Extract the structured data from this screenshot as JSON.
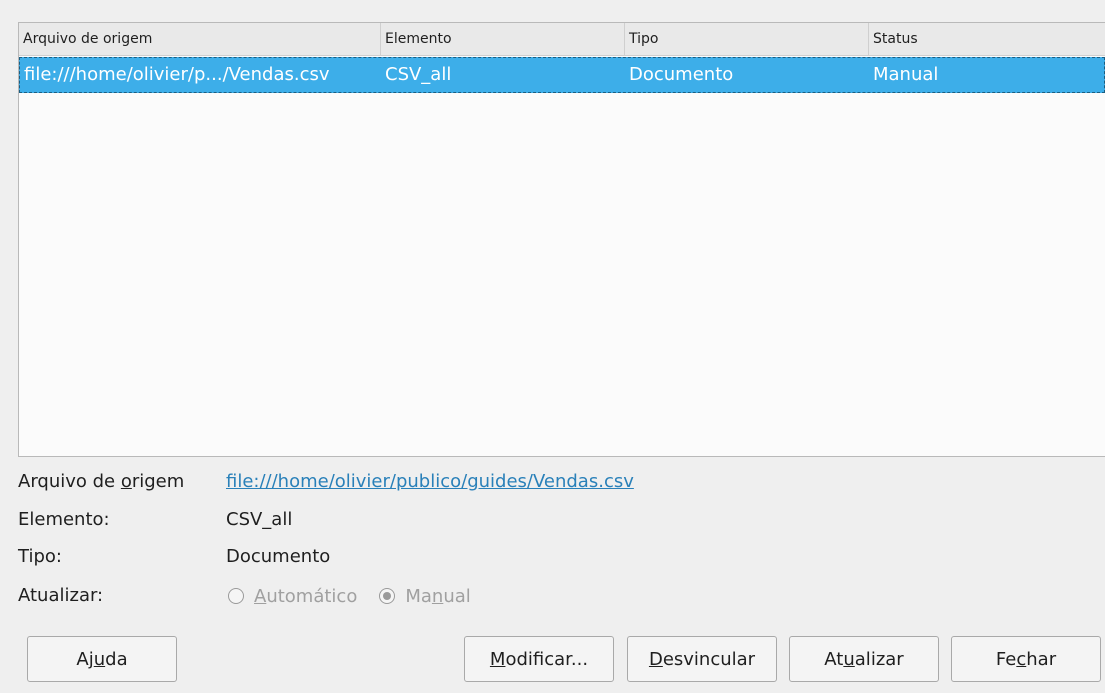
{
  "table": {
    "headers": [
      "Arquivo de origem",
      "Elemento",
      "Tipo",
      "Status"
    ],
    "rows": [
      [
        "file:///home/olivier/p.../Vendas.csv",
        "CSV_all",
        "Documento",
        "Manual"
      ]
    ]
  },
  "details": {
    "source_label_before": "Arquivo de ",
    "source_label_mnemonic": "o",
    "source_label_after": "rigem",
    "source_value": "file:///home/olivier/publico/guides/Vendas.csv",
    "element_label": "Elemento:",
    "element_value": "CSV_all",
    "type_label": "Tipo:",
    "type_value": "Documento",
    "update_label": "Atualizar:",
    "update_options": [
      {
        "before": "",
        "mnemonic": "A",
        "after": "utomático",
        "checked": false,
        "enabled": false
      },
      {
        "before": "Ma",
        "mnemonic": "n",
        "after": "ual",
        "checked": true,
        "enabled": false
      }
    ]
  },
  "buttons": {
    "help": {
      "before": "Aj",
      "mnemonic": "u",
      "after": "da"
    },
    "modify": {
      "before": "",
      "mnemonic": "M",
      "after": "odificar..."
    },
    "unlink": {
      "before": "",
      "mnemonic": "D",
      "after": "esvincular"
    },
    "update": {
      "before": "At",
      "mnemonic": "u",
      "after": "alizar"
    },
    "close": {
      "before": "Fe",
      "mnemonic": "c",
      "after": "har"
    }
  },
  "colors": {
    "selection": "#3daee9",
    "link": "#2980b9"
  }
}
